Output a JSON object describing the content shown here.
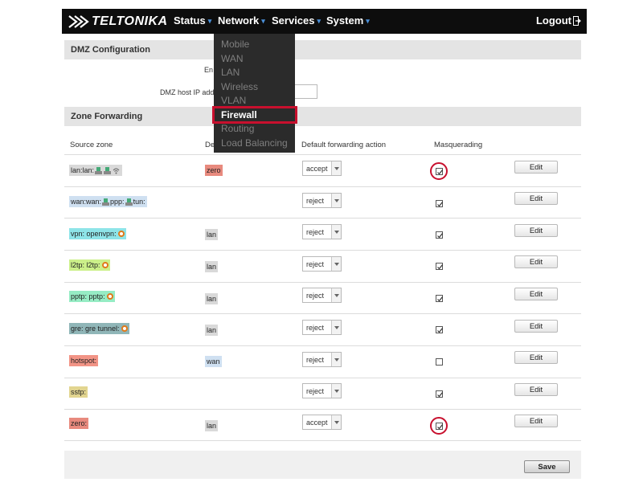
{
  "header": {
    "logo_text": "TELTONIKA",
    "nav": [
      {
        "label": "Status"
      },
      {
        "label": "Network"
      },
      {
        "label": "Services"
      },
      {
        "label": "System"
      }
    ],
    "logout_label": "Logout"
  },
  "network_menu": {
    "items": [
      "Mobile",
      "WAN",
      "LAN",
      "Wireless",
      "VLAN",
      "Firewall",
      "Routing",
      "Load Balancing"
    ],
    "active": "Firewall"
  },
  "dmz": {
    "title": "DMZ Configuration",
    "enable_label": "En",
    "host_ip_label": "DMZ host IP add"
  },
  "zone_forwarding": {
    "title": "Zone Forwarding",
    "columns": [
      "Source zone",
      "De",
      "Default forwarding action",
      "Masquerading"
    ],
    "edit_label": "Edit",
    "rows": [
      {
        "source": "lan:",
        "source_detail": "lan:",
        "dest": "zero",
        "action": "accept",
        "masq": true
      },
      {
        "source": "wan:",
        "source_detail": "wan:",
        "source_detail2": "ppp:",
        "source_detail3": "tun:",
        "dest": "",
        "action": "reject",
        "masq": true
      },
      {
        "source": "vpn:",
        "source_detail": "openvpn:",
        "dest": "lan",
        "action": "reject",
        "masq": true
      },
      {
        "source": "l2tp:",
        "source_detail": "l2tp:",
        "dest": "lan",
        "action": "reject",
        "masq": true
      },
      {
        "source": "pptp:",
        "source_detail": "pptp:",
        "dest": "lan",
        "action": "reject",
        "masq": true
      },
      {
        "source": "gre:",
        "source_detail": "gre tunnel:",
        "dest": "lan",
        "action": "reject",
        "masq": true
      },
      {
        "source": "hotspot:",
        "source_detail": "",
        "dest": "wan",
        "action": "reject",
        "masq": false
      },
      {
        "source": "sstp:",
        "source_detail": "",
        "dest": "",
        "action": "reject",
        "masq": true
      },
      {
        "source": "zero:",
        "source_detail": "",
        "dest": "lan",
        "action": "accept",
        "masq": true
      }
    ]
  },
  "save_label": "Save",
  "colors": {
    "lan": "#d9d9d9",
    "zero": "#e88a7e",
    "wan": "#cfe0f1",
    "vpn": "#8ee4e8",
    "l2tp": "#ccf08a",
    "pptp": "#96ecc4",
    "gre": "#90b6b8",
    "hotspot": "#f29486",
    "sstp": "#e2d590",
    "highlight": "#c8102e"
  }
}
